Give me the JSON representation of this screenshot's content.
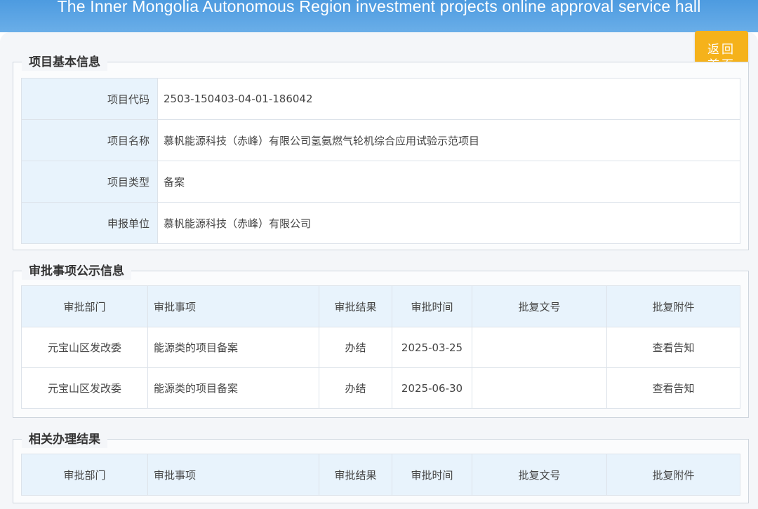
{
  "banner": {
    "title": "The Inner Mongolia Autonomous Region investment projects online approval service hall"
  },
  "home_button": {
    "line1": "返回",
    "line2": "首页"
  },
  "basic_info": {
    "legend": "项目基本信息",
    "rows": [
      {
        "label": "项目代码",
        "value": "2503-150403-04-01-186042"
      },
      {
        "label": "项目名称",
        "value": "慕帆能源科技（赤峰）有限公司氢氨燃气轮机综合应用试验示范项目"
      },
      {
        "label": "项目类型",
        "value": "备案"
      },
      {
        "label": "申报单位",
        "value": "慕帆能源科技（赤峰）有限公司"
      }
    ]
  },
  "approval_info": {
    "legend": "审批事项公示信息",
    "headers": [
      "审批部门",
      "审批事项",
      "审批结果",
      "审批时间",
      "批复文号",
      "批复附件"
    ],
    "rows": [
      {
        "dept": "元宝山区发改委",
        "item": "能源类的项目备案",
        "result": "办结",
        "time": "2025-03-25",
        "doc_no": "",
        "attachment": "查看告知"
      },
      {
        "dept": "元宝山区发改委",
        "item": "能源类的项目备案",
        "result": "办结",
        "time": "2025-06-30",
        "doc_no": "",
        "attachment": "查看告知"
      }
    ]
  },
  "related_results": {
    "legend": "相关办理结果",
    "headers": [
      "审批部门",
      "审批事项",
      "审批结果",
      "审批时间",
      "批复文号",
      "批复附件"
    ]
  },
  "colors": {
    "banner": "#5ea6e6",
    "home_button": "#f5b21b",
    "label_bg": "#e8f3fc",
    "border": "#dde3ea"
  }
}
